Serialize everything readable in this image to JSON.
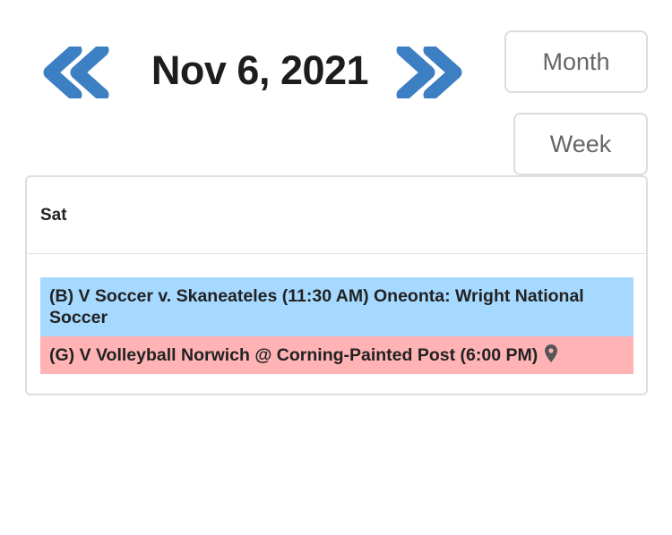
{
  "header": {
    "date_title": "Nov 6, 2021",
    "prev_icon": "double-chevron-left-icon",
    "next_icon": "double-chevron-right-icon",
    "accent_color": "#3d7fc3"
  },
  "views": {
    "month_label": "Month",
    "week_label": "Week"
  },
  "day": {
    "label": "Sat",
    "events": [
      {
        "text": "(B) V Soccer v. Skaneateles (11:30 AM) Oneonta: Wright National Soccer",
        "color": "#a6d9ff"
      },
      {
        "text": "(G) V Volleyball Norwich @ Corning-Painted Post (6:00 PM)",
        "color": "#ffb3b5",
        "icon": "map-pin-icon"
      }
    ]
  }
}
